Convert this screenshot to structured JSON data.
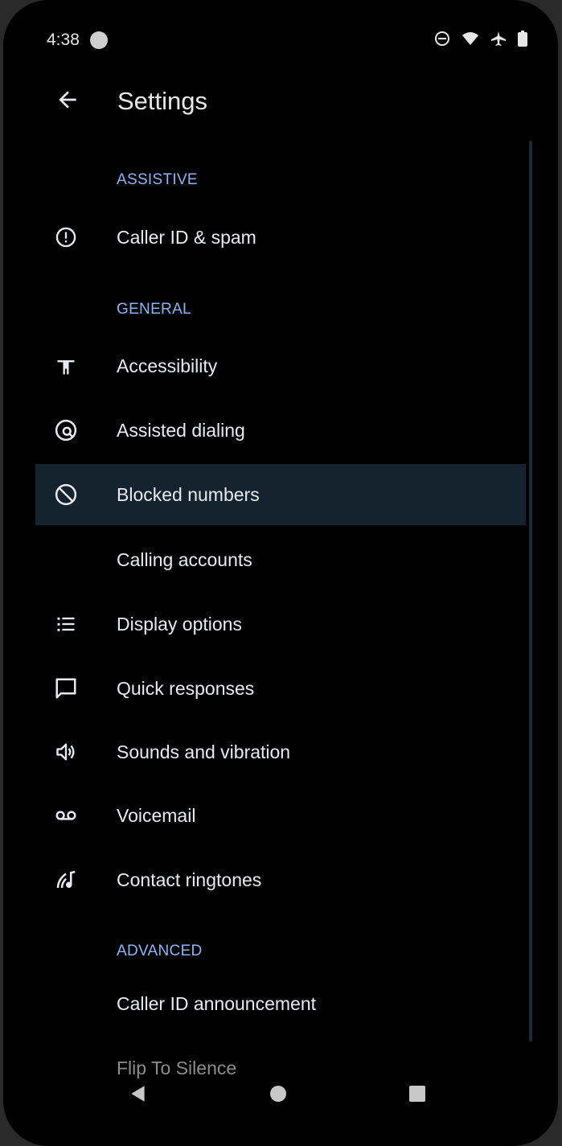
{
  "status_bar": {
    "time": "4:38"
  },
  "app_bar": {
    "title": "Settings"
  },
  "sections": {
    "assistive": {
      "header": "ASSISTIVE"
    },
    "general": {
      "header": "GENERAL"
    },
    "advanced": {
      "header": "ADVANCED"
    }
  },
  "items": {
    "caller_id_spam": {
      "label": "Caller ID & spam",
      "icon": "info-icon"
    },
    "accessibility": {
      "label": "Accessibility",
      "icon": "accessibility-icon"
    },
    "assisted_dialing": {
      "label": "Assisted dialing",
      "icon": "assisted-dialing-icon"
    },
    "blocked_numbers": {
      "label": "Blocked numbers",
      "icon": "block-icon"
    },
    "calling_accounts": {
      "label": "Calling accounts"
    },
    "display_options": {
      "label": "Display options",
      "icon": "list-icon"
    },
    "quick_responses": {
      "label": "Quick responses",
      "icon": "message-icon"
    },
    "sounds_vibration": {
      "label": "Sounds and vibration",
      "icon": "volume-icon"
    },
    "voicemail": {
      "label": "Voicemail",
      "icon": "voicemail-icon"
    },
    "contact_ringtones": {
      "label": "Contact ringtones",
      "icon": "ringtone-icon"
    },
    "caller_id_announcement": {
      "label": "Caller ID announcement"
    },
    "flip_to_silence": {
      "label": "Flip To Silence"
    }
  },
  "colors": {
    "accent": "#8ab4f8",
    "background": "#000000",
    "highlight": "#15232f",
    "text": "#e8eaed"
  }
}
